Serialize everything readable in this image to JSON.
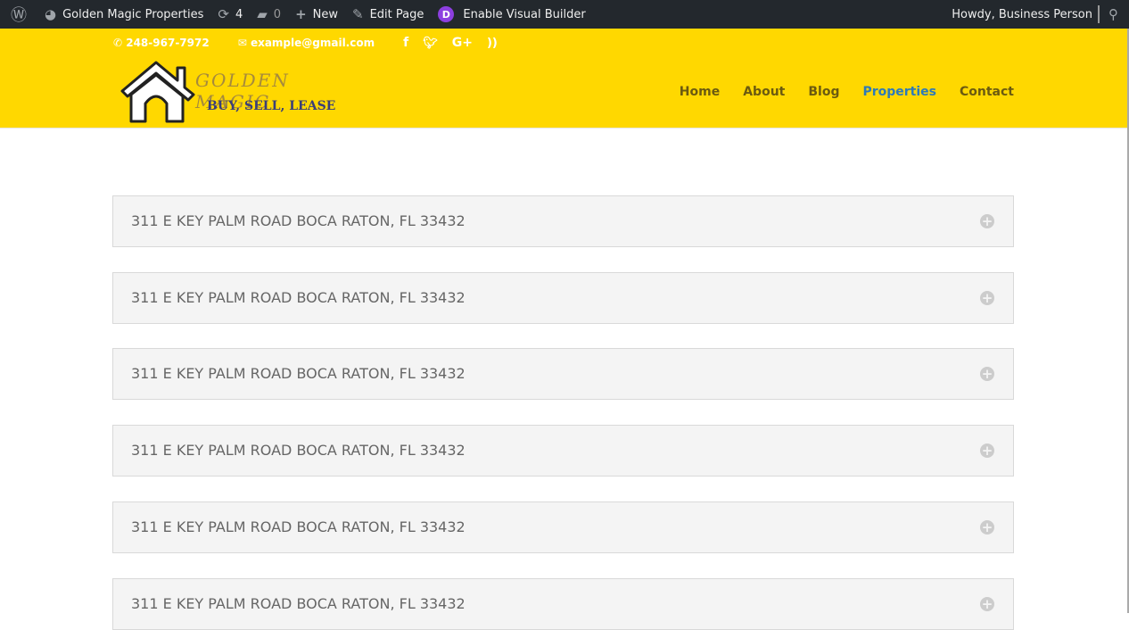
{
  "adminbar": {
    "site": "Golden Magic Properties",
    "updates": "4",
    "comments": "0",
    "new": "New",
    "edit": "Edit Page",
    "visual": "Enable Visual Builder",
    "howdy": "Howdy, Business Person"
  },
  "topinfo": {
    "phone": "248-967-7972",
    "email": "example@gmail.com"
  },
  "logo": {
    "line1": "GOLDEN MAGIC",
    "line2": "BUY, SELL, LEASE"
  },
  "nav": [
    "Home",
    "About",
    "Blog",
    "Properties",
    "Contact"
  ],
  "accordion": [
    "311 E KEY PALM ROAD BOCA RATON, FL 33432",
    "311 E KEY PALM ROAD BOCA RATON, FL 33432",
    "311 E KEY PALM ROAD BOCA RATON, FL 33432",
    "311 E KEY PALM ROAD BOCA RATON, FL 33432",
    "311 E KEY PALM ROAD BOCA RATON, FL 33432",
    "311 E KEY PALM ROAD BOCA RATON, FL 33432"
  ]
}
